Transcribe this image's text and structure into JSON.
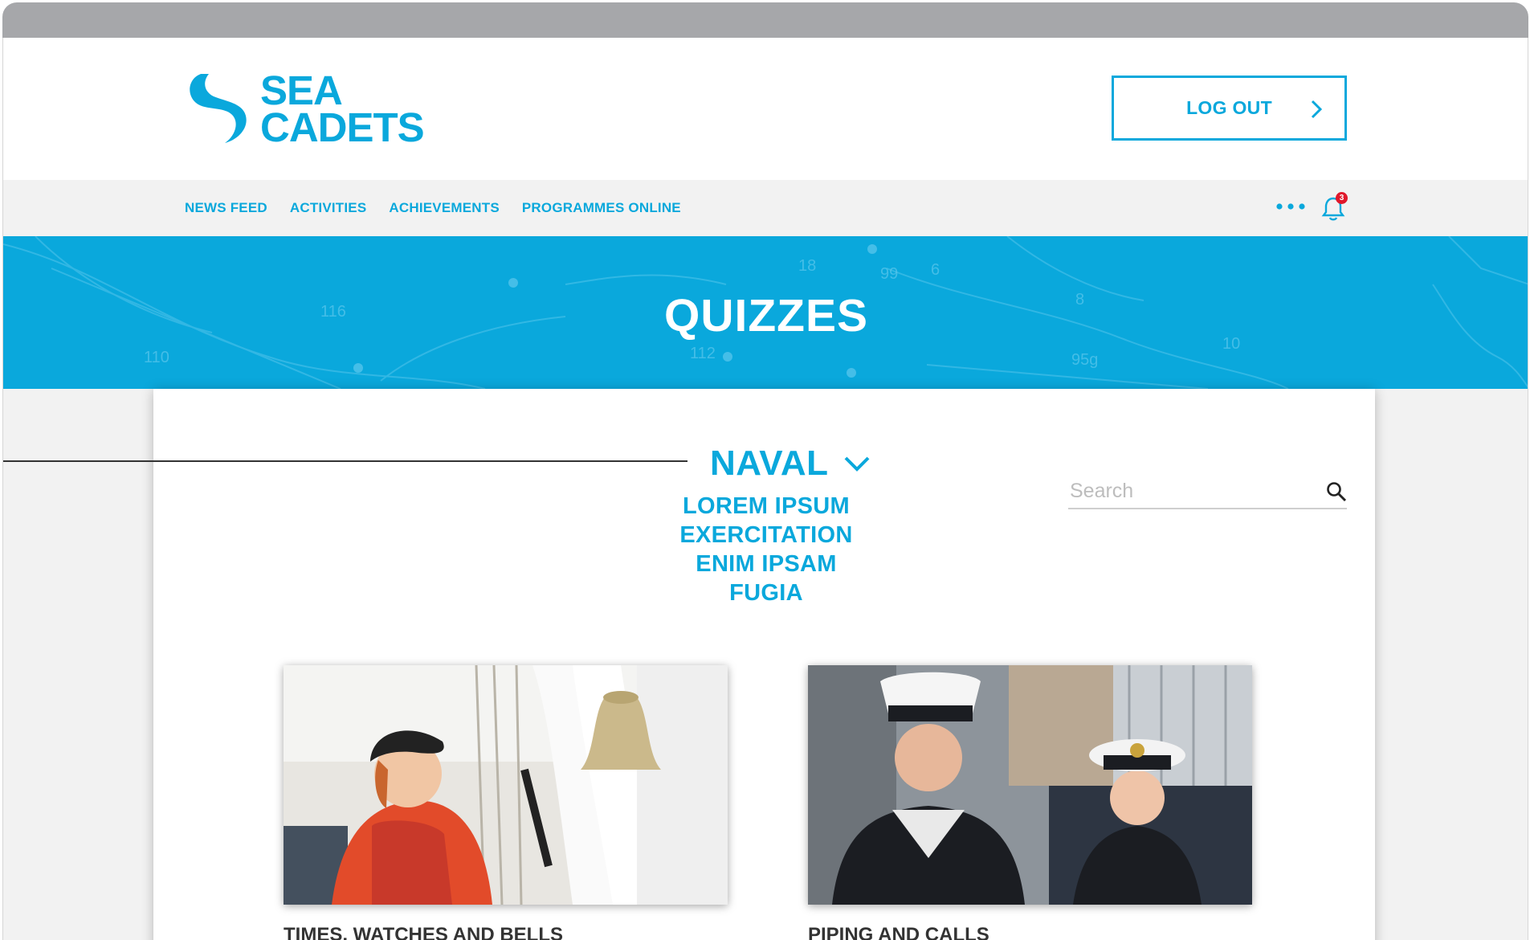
{
  "brand": {
    "logo_line1": "SEA",
    "logo_line2": "CADETS",
    "color": "#0aa8dc"
  },
  "header": {
    "logout_label": "LOG OUT"
  },
  "nav": {
    "items": [
      {
        "label": "NEWS FEED"
      },
      {
        "label": "ACTIVITIES"
      },
      {
        "label": "ACHIEVEMENTS"
      },
      {
        "label": "PROGRAMMES ONLINE"
      }
    ],
    "notification_count": "3",
    "icons": [
      "more-icon",
      "bell-icon"
    ]
  },
  "hero": {
    "title": "QUIZZES"
  },
  "filter": {
    "selected": "NAVAL",
    "options": [
      {
        "label": "LOREM IPSUM"
      },
      {
        "label": "EXERCITATION"
      },
      {
        "label": "ENIM IPSAM"
      },
      {
        "label": "FUGIA"
      }
    ]
  },
  "search": {
    "placeholder": "Search",
    "value": ""
  },
  "quizzes": [
    {
      "title": "TIMES, WATCHES AND BELLS"
    },
    {
      "title": "PIPING AND CALLS"
    }
  ]
}
